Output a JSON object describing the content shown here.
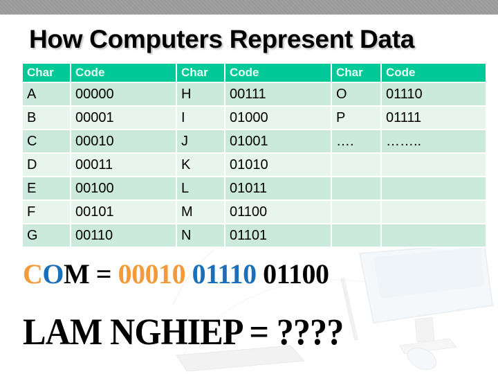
{
  "slide": {
    "title": "How Computers Represent Data"
  },
  "table": {
    "headers": [
      "Char",
      "Code",
      "Char",
      "Code",
      "Char",
      "Code"
    ],
    "rows": [
      [
        "A",
        "00000",
        "H",
        "00111",
        "O",
        "01110"
      ],
      [
        "B",
        "00001",
        "I",
        "01000",
        "P",
        "01111"
      ],
      [
        "C",
        "00010",
        "J",
        "01001",
        "….",
        "…….."
      ],
      [
        "D",
        "00011",
        "K",
        "01010",
        "",
        ""
      ],
      [
        "E",
        "00100",
        "L",
        "01011",
        "",
        ""
      ],
      [
        "F",
        "00101",
        "M",
        "01100",
        "",
        ""
      ],
      [
        "G",
        "00110",
        "N",
        "01101",
        "",
        ""
      ]
    ]
  },
  "example": {
    "letter_c": "C",
    "letter_o": "O",
    "letter_m": "M",
    "equals": " = ",
    "code_c": "00010",
    "code_o": "01110",
    "code_m": "01100",
    "colors": {
      "c": "#f39a3a",
      "o": "#1a6fb8",
      "m": "#000000"
    }
  },
  "exercise": {
    "text": "LAM NGHIEP = ????"
  },
  "theme": {
    "header_color": "#00c896",
    "row_dark": "#cce9dd",
    "row_light": "#e8f4ee"
  }
}
